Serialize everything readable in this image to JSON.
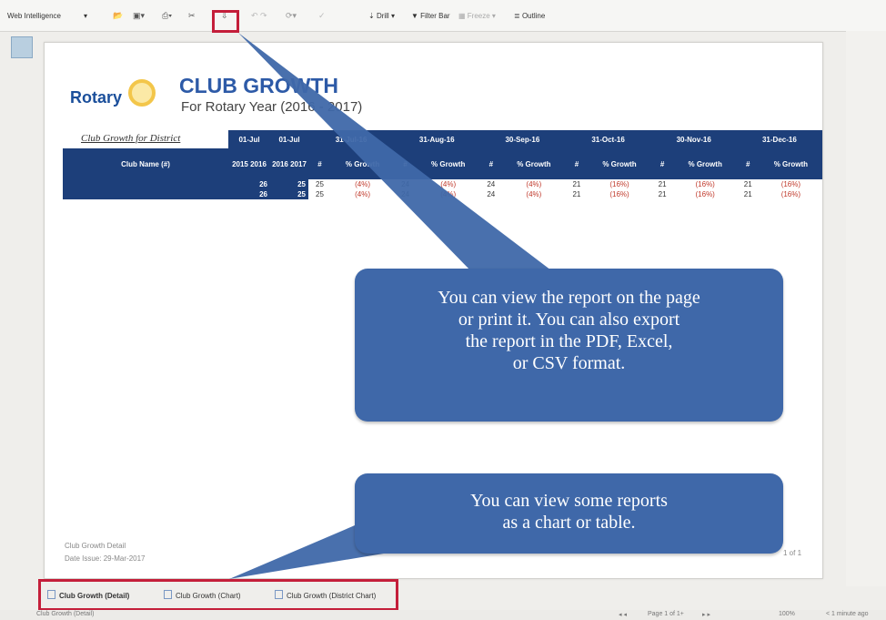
{
  "toolbar": {
    "app_menu": "Web Intelligence",
    "items": [
      "Drill",
      "Filter Bar",
      "Freeze",
      "Outline"
    ]
  },
  "report": {
    "logo_text": "Rotary",
    "title": "CLUB GROWTH",
    "subtitle": "For Rotary Year (2016 - 2017)",
    "district_label": "Club Growth for District",
    "column_dates": [
      "01-Jul",
      "01-Jul",
      "31-Jul-16",
      "31-Aug-16",
      "30-Sep-16",
      "31-Oct-16",
      "30-Nov-16",
      "31-Dec-16"
    ],
    "subheaders": [
      "Club Name (#)",
      "2015 2016",
      "2016 2017",
      "#",
      "% Growth",
      "#",
      "% Growth",
      "#",
      "% Growth",
      "#",
      "% Growth",
      "#",
      "% Growth",
      "#",
      "% Growth"
    ],
    "rows": [
      [
        "",
        "26",
        "25",
        "25",
        "(4%)",
        "24",
        "(4%)",
        "24",
        "(4%)",
        "21",
        "(16%)",
        "21",
        "(16%)",
        "21",
        "(16%)"
      ],
      [
        "",
        "26",
        "25",
        "25",
        "(4%)",
        "24",
        "(4%)",
        "24",
        "(4%)",
        "21",
        "(16%)",
        "21",
        "(16%)",
        "21",
        "(16%)"
      ]
    ],
    "footer_left_1": "Club Growth Detail",
    "footer_left_2": "Date Issue: 29-Mar-2017",
    "footer_right": "1 of 1"
  },
  "callouts": {
    "export_lines": [
      "You can view the report on the page",
      "or print it. You can also export",
      "the report in the PDF, Excel,",
      "or CSV format."
    ],
    "chart_lines": [
      "You can view some reports",
      "as a chart or table."
    ]
  },
  "tabs": [
    "Club Growth (Detail)",
    "Club Growth (Chart)",
    "Club Growth (District Chart)"
  ],
  "status": {
    "left": "Club Growth (Detail)",
    "page": "Page 1 of 1+",
    "zoom": "100%",
    "refresh": "< 1 minute ago"
  },
  "colors": {
    "header_blue": "#1d3f7a",
    "callout_blue": "#3f68a9",
    "highlight_red": "#c41e3a"
  }
}
